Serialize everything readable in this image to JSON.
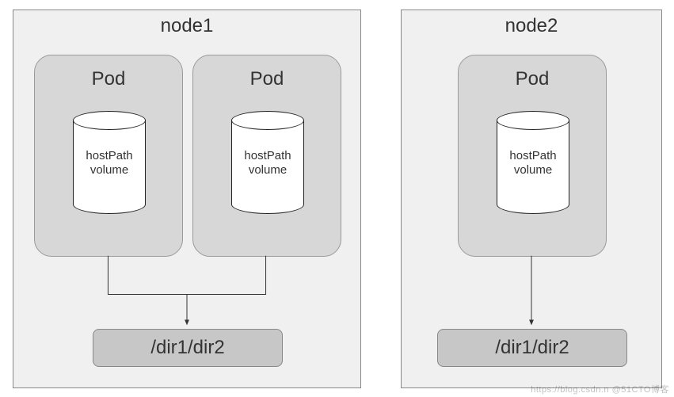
{
  "nodes": {
    "node1": {
      "title": "node1",
      "pods": {
        "podA": {
          "title": "Pod",
          "volume_line1": "hostPath",
          "volume_line2": "volume"
        },
        "podB": {
          "title": "Pod",
          "volume_line1": "hostPath",
          "volume_line2": "volume"
        }
      },
      "dir_path": "/dir1/dir2"
    },
    "node2": {
      "title": "node2",
      "pods": {
        "podC": {
          "title": "Pod",
          "volume_line1": "hostPath",
          "volume_line2": "volume"
        }
      },
      "dir_path": "/dir1/dir2"
    }
  },
  "watermark": "https://blog.csdn.n @51CTO博客",
  "chart_data": {
    "type": "diagram",
    "description": "Kubernetes hostPath volume concept: Pods on a node mount a hostPath volume that maps to a directory on that node's filesystem. Multiple Pods on the same node share the host directory; each node has its own copy.",
    "nodes": [
      {
        "name": "node1",
        "pods": [
          {
            "name": "Pod",
            "volume_type": "hostPath volume"
          },
          {
            "name": "Pod",
            "volume_type": "hostPath volume"
          }
        ],
        "host_directory": "/dir1/dir2"
      },
      {
        "name": "node2",
        "pods": [
          {
            "name": "Pod",
            "volume_type": "hostPath volume"
          }
        ],
        "host_directory": "/dir1/dir2"
      }
    ],
    "edges": [
      {
        "from": "node1.pod[0].hostPathVolume",
        "to": "node1./dir1/dir2"
      },
      {
        "from": "node1.pod[1].hostPathVolume",
        "to": "node1./dir1/dir2"
      },
      {
        "from": "node2.pod[0].hostPathVolume",
        "to": "node2./dir1/dir2"
      }
    ]
  }
}
